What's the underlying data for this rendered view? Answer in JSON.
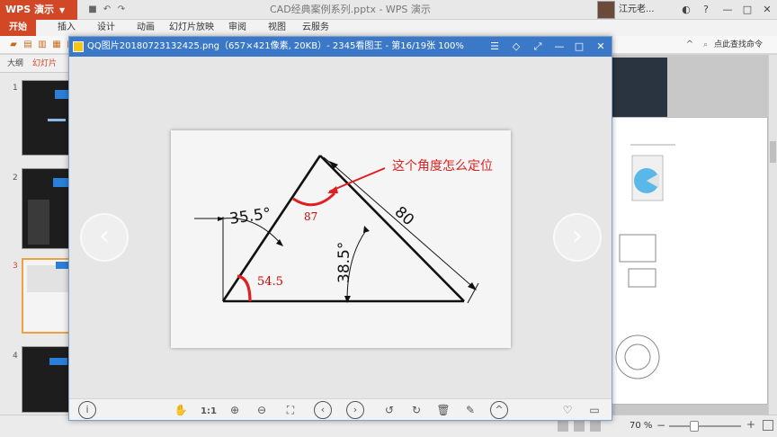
{
  "wps": {
    "app_name": "WPS 演示",
    "doc_title": "CAD经典案例系列.pptx - WPS 演示",
    "user_name": "江元老...",
    "search_placeholder": "点此查找命令"
  },
  "menu": [
    "开始",
    "插入",
    "设计",
    "动画",
    "幻灯片放映",
    "审阅",
    "视图",
    "云服务"
  ],
  "left_panel": {
    "tabs": [
      "大纲",
      "幻灯片"
    ],
    "slide_numbers": [
      "1",
      "2",
      "3",
      "4"
    ]
  },
  "status": {
    "zoom_label": "70 %",
    "zoom_level": 0.35
  },
  "viewer": {
    "title": "QQ图片20180723132425.png（657×421像素, 20KB）- 2345看图王 - 第16/19张 100%",
    "ratio_label": "1:1",
    "icons": [
      "info-icon",
      "hand-icon",
      "ratio-icon",
      "zoom-in-icon",
      "zoom-out-icon",
      "fit-icon",
      "prev-icon",
      "next-icon",
      "rotate-left-icon",
      "rotate-right-icon",
      "delete-icon",
      "edit-icon",
      "more-icon",
      "favorite-icon",
      "folder-icon"
    ]
  },
  "drawing": {
    "question": "这个角度怎么定位",
    "label_87": "87",
    "label_80": "80",
    "label_355": "35.5°",
    "label_385": "38.5°",
    "label_545": "54.5",
    "accent_red": "#e02020"
  }
}
